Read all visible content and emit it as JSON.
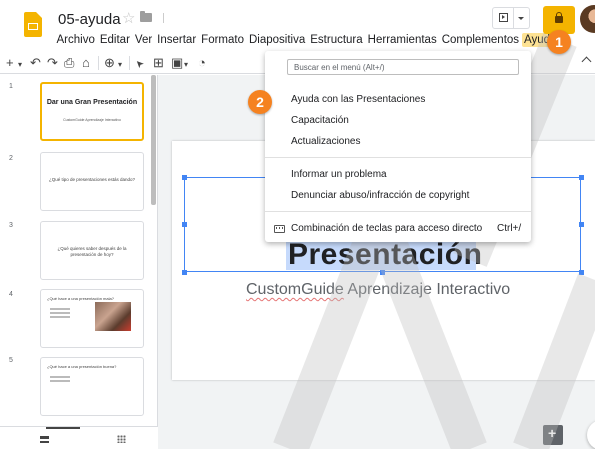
{
  "app": {
    "doc_title": "05-ayuda",
    "menus": [
      "Archivo",
      "Editar",
      "Ver",
      "Insertar",
      "Formato",
      "Diapositiva",
      "Estructura",
      "Herramientas",
      "Complementos",
      "Ayuda"
    ],
    "active_menu": "Ayuda",
    "accent": "#f4b400"
  },
  "toolbar": {
    "add": "+",
    "add_dd": "▾",
    "undo": "↶",
    "redo": "↷",
    "print": "⎙",
    "paint": "⌂",
    "zoom": "⊕",
    "zoom_dd": "▾",
    "cursor": "➤",
    "textbox": "⊞",
    "image": "▣",
    "image_dd": "▾",
    "shape": "◔"
  },
  "callouts": {
    "one": "1",
    "two": "2"
  },
  "help_menu": {
    "search_placeholder": "Buscar en el menú (Alt+/)",
    "items": [
      "Ayuda con las Presentaciones",
      "Capacitación",
      "Actualizaciones",
      "Informar un problema",
      "Denunciar abuso/infracción de copyright",
      "Combinación de teclas para acceso directo"
    ],
    "shortcut": "Ctrl+/"
  },
  "filmstrip": {
    "slides": [
      {
        "num": "1",
        "title": "Dar una Gran Presentación",
        "subtitle": "CustomGuide Aprendizaje Interactivo"
      },
      {
        "num": "2",
        "text": "¿Qué tipo de presentaciones estás dando?"
      },
      {
        "num": "3",
        "text": "¿Qué quieres saber después de la presentación de hoy?"
      },
      {
        "num": "4",
        "text": "¿Qué hace a una presentación mala?"
      },
      {
        "num": "5",
        "text": "¿Qué hace a una presentación buena?"
      }
    ]
  },
  "slide": {
    "title_line2": "Presentación",
    "subtitle_word1": "CustomGuide",
    "subtitle_rest": " Aprendizaje Interactivo"
  }
}
